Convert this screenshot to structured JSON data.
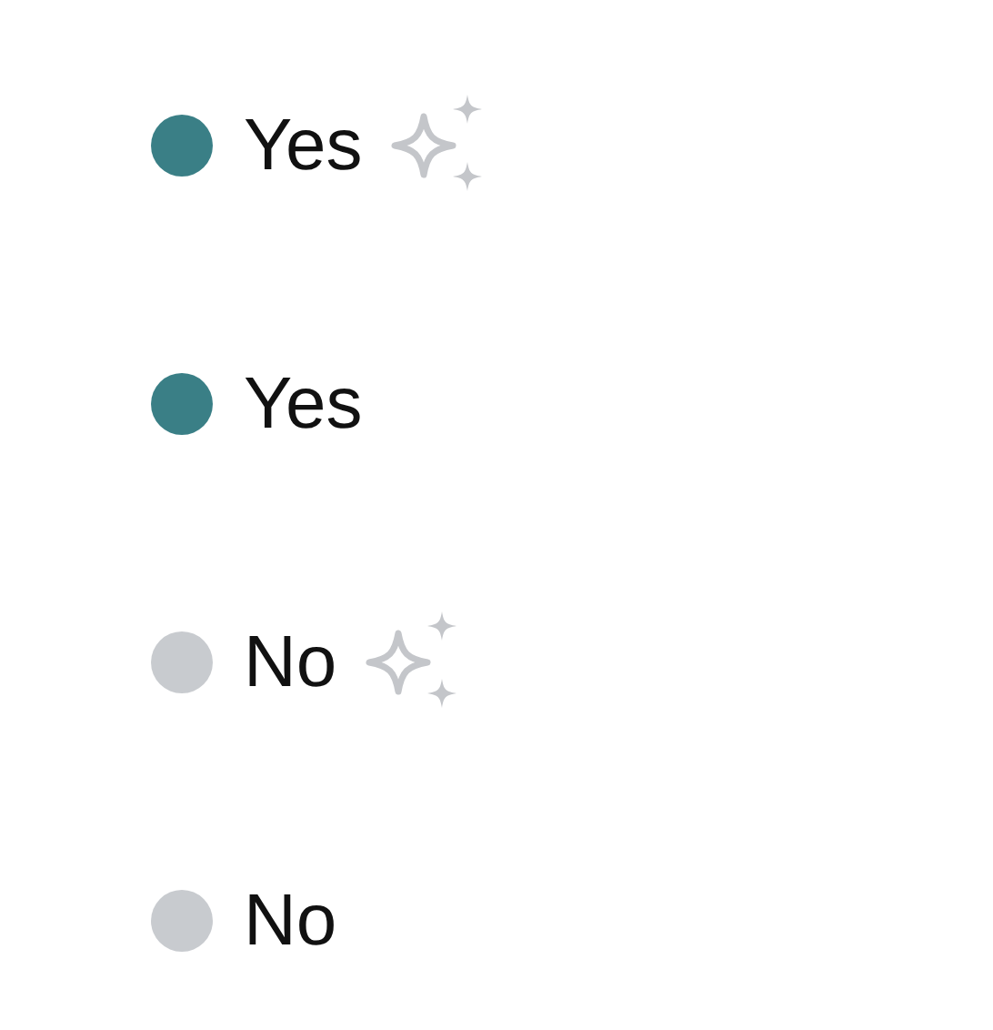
{
  "items": [
    {
      "label": "Yes",
      "color": "#3a7f86",
      "sparkle": true
    },
    {
      "label": "Yes",
      "color": "#3a7f86",
      "sparkle": false
    },
    {
      "label": "No",
      "color": "#c8cbcf",
      "sparkle": true
    },
    {
      "label": "No",
      "color": "#c8cbcf",
      "sparkle": false
    }
  ]
}
